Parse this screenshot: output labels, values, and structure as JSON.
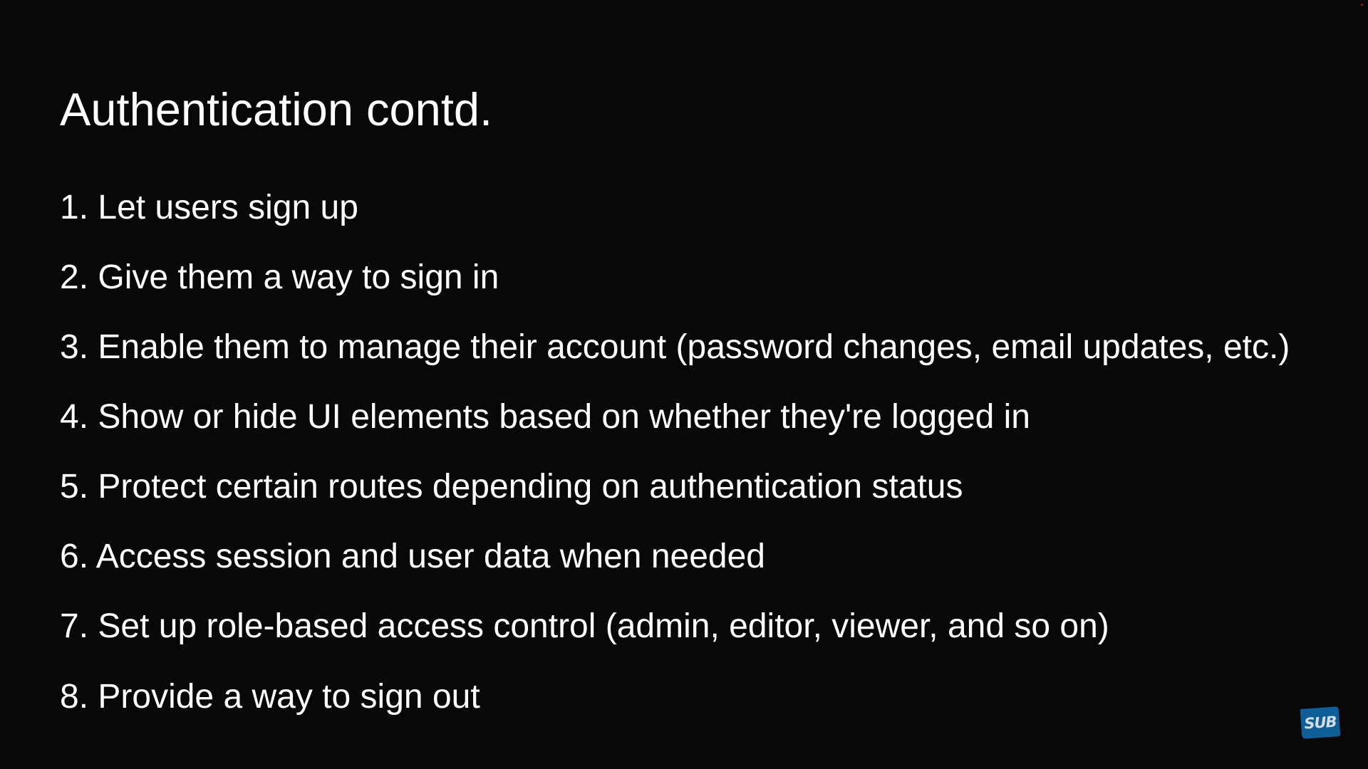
{
  "slide": {
    "title": "Authentication contd.",
    "items": [
      "1. Let users sign up",
      "2. Give them a way to sign in",
      "3. Enable them to manage their account (password changes, email updates, etc.)",
      "4. Show or hide UI elements based on whether they're logged in",
      "5. Protect certain routes depending on authentication status",
      "6. Access session and user data when needed",
      "7. Set up role-based access control (admin, editor, viewer, and so on)",
      "8. Provide a way to sign out"
    ]
  },
  "watermark": {
    "label": "SUB",
    "color": "#0e5f98"
  },
  "colors": {
    "background": "#080808",
    "text": "#ffffff"
  }
}
